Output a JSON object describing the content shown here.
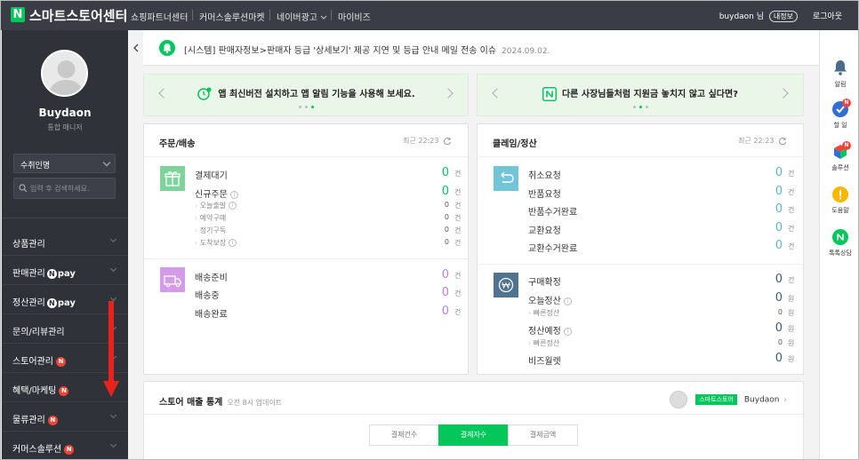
{
  "topbar": {
    "logo_letter": "N",
    "app_title": "스마트스토어센터",
    "nav": [
      "쇼핑파트너센터",
      "커머스솔루션마켓",
      "네이버광고",
      "마이비즈"
    ],
    "user_name": "buydaon 님",
    "user_badge": "내정보",
    "logout": "로그아웃"
  },
  "sidebar": {
    "name": "Buydaon",
    "role": "통합 매니저",
    "select_value": "수취인명",
    "search_placeholder": "입력 후 검색하세요.",
    "items": [
      {
        "label": "상품관리",
        "badge": ""
      },
      {
        "label": "판매관리",
        "badge": "npay"
      },
      {
        "label": "정산관리",
        "badge": "npay"
      },
      {
        "label": "문의/리뷰관리",
        "badge": ""
      },
      {
        "label": "스토어관리",
        "badge": "N"
      },
      {
        "label": "혜택/마케팅",
        "badge": "N"
      },
      {
        "label": "물류관리",
        "badge": "N"
      },
      {
        "label": "커머스솔루션",
        "badge": "N"
      }
    ],
    "npay_n": "N",
    "npay_text": "pay",
    "badge_n": "N"
  },
  "notice": {
    "text": "[시스템] 판매자정보>판매자 등급 '상세보기' 제공 지연 및 등급 안내 메일 전송 이슈",
    "date": "2024.09.02."
  },
  "banners": [
    {
      "text": "앱 최신버전 설치하고 앱 알림 기능을 사용해 보세요."
    },
    {
      "text": "다른 사장님들처럼 지원금 놓치지 않고 싶다면?"
    }
  ],
  "orders": {
    "title": "주문/배송",
    "time": "최근 22:23",
    "group1": [
      {
        "label": "결제대기",
        "value": "0",
        "unit": "건",
        "info": false,
        "sub": false
      },
      {
        "label": "신규주문",
        "value": "0",
        "unit": "건",
        "info": true,
        "sub": false
      },
      {
        "label": "오늘출발",
        "value": "0",
        "unit": "건",
        "info": true,
        "sub": true
      },
      {
        "label": "예약구매",
        "value": "0",
        "unit": "건",
        "info": false,
        "sub": true
      },
      {
        "label": "정기구독",
        "value": "0",
        "unit": "건",
        "info": false,
        "sub": true
      },
      {
        "label": "도착보장",
        "value": "0",
        "unit": "건",
        "info": true,
        "sub": true
      }
    ],
    "group2": [
      {
        "label": "배송준비",
        "value": "0",
        "unit": "건"
      },
      {
        "label": "배송중",
        "value": "0",
        "unit": "건"
      },
      {
        "label": "배송완료",
        "value": "0",
        "unit": "건"
      }
    ]
  },
  "claims": {
    "title": "클레임/정산",
    "time": "최근 22:23",
    "group1": [
      {
        "label": "취소요청",
        "value": "0",
        "unit": "건"
      },
      {
        "label": "반품요청",
        "value": "0",
        "unit": "건"
      },
      {
        "label": "반품수거완료",
        "value": "0",
        "unit": "건"
      },
      {
        "label": "교환요청",
        "value": "0",
        "unit": "건"
      },
      {
        "label": "교환수거완료",
        "value": "0",
        "unit": "건"
      }
    ],
    "group2": [
      {
        "label": "구매확정",
        "value": "0",
        "unit": "건",
        "info": false,
        "sub": false
      },
      {
        "label": "오늘정산",
        "value": "0",
        "unit": "원",
        "info": true,
        "sub": false
      },
      {
        "label": "빠른정산",
        "value": "0",
        "unit": "원",
        "info": false,
        "sub": true
      },
      {
        "label": "정산예정",
        "value": "0",
        "unit": "원",
        "info": true,
        "sub": false
      },
      {
        "label": "빠른정산",
        "value": "0",
        "unit": "원",
        "info": false,
        "sub": true
      },
      {
        "label": "비즈월렛",
        "value": "0",
        "unit": "원",
        "info": false,
        "sub": false
      }
    ]
  },
  "rail": [
    {
      "label": "알림",
      "icon": "bell-icon",
      "new": false
    },
    {
      "label": "할 일",
      "icon": "check-icon",
      "new": true
    },
    {
      "label": "솔루션",
      "icon": "cube-icon",
      "new": true
    },
    {
      "label": "도움말",
      "icon": "help-icon",
      "new": false
    },
    {
      "label": "톡톡상담",
      "icon": "talk-icon",
      "new": false
    }
  ],
  "stats": {
    "title": "스토어 매출 통계",
    "sub": "오전 8시 업데이트",
    "store_badge": "스마트스토어",
    "store_name": "Buydaon",
    "tabs": [
      "결제건수",
      "결제자수",
      "결제금액"
    ],
    "active_tab": 1
  },
  "colors": {
    "brand": "#03c75a",
    "order_value": "#03c75a",
    "delivery_value": "#c27ce0",
    "claim_value": "#5bb8d0",
    "settle_value": "#3a5b7a"
  }
}
